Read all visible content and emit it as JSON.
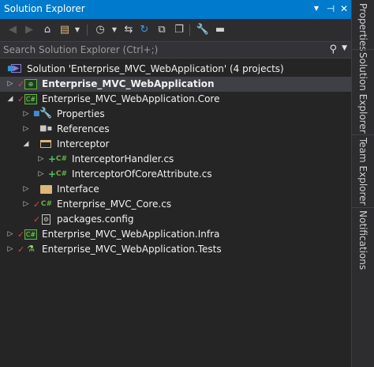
{
  "window": {
    "title": "Solution Explorer",
    "buttons": {
      "dropdown": "▼",
      "pin": "⊣",
      "close": "✕"
    }
  },
  "toolbar": {
    "icons": [
      "back-icon",
      "forward-icon",
      "home-icon",
      "switch-views-icon",
      "history-icon",
      "sync-icon",
      "refresh-icon",
      "collapse-all-icon",
      "show-all-files-icon",
      "properties-icon",
      "preview-icon"
    ]
  },
  "search": {
    "placeholder": "Search Solution Explorer (Ctrl+;)"
  },
  "tree": {
    "solution": {
      "label": "Solution 'Enterprise_MVC_WebApplication' (4 projects)"
    },
    "items": [
      {
        "label": "Enterprise_MVC_WebApplication",
        "bold": true,
        "selected": true
      },
      {
        "label": "Enterprise_MVC_WebApplication.Core"
      },
      {
        "label": "Properties"
      },
      {
        "label": "References"
      },
      {
        "label": "Interceptor"
      },
      {
        "label": "InterceptorHandler.cs"
      },
      {
        "label": "InterceptorOfCoreAttribute.cs"
      },
      {
        "label": "Interface"
      },
      {
        "label": "Enterprise_MVC_Core.cs"
      },
      {
        "label": "packages.config"
      },
      {
        "label": "Enterprise_MVC_WebApplication.Infra"
      },
      {
        "label": "Enterprise_MVC_WebApplication.Tests"
      }
    ]
  },
  "side_tabs": [
    "Properties",
    "Solution Explorer",
    "Team Explorer",
    "Notifications"
  ],
  "colors": {
    "accent": "#007acc",
    "background": "#252526",
    "selected_row": "#3f3f46",
    "checkmark_red": "#e04040",
    "plus_green": "#52c15f",
    "folder": "#dcb67a"
  }
}
